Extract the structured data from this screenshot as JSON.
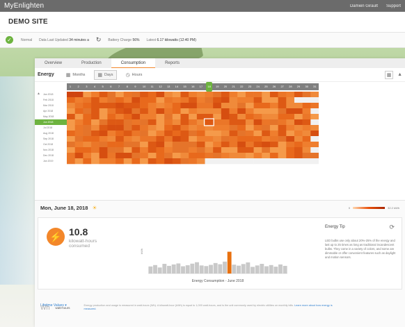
{
  "app": {
    "brand": "MyEnlighten",
    "user": "Damien Girault",
    "support": "Support"
  },
  "site": {
    "name": "DEMO SITE"
  },
  "status": {
    "state": "Normal",
    "updated_label": "Data Last Updated",
    "updated_value": "34 minutes a",
    "battery_label": "Battery Charge",
    "battery_value": "56%",
    "latest_label": "Latest",
    "latest_value": "6.17 kilowatts (12:40 PM)"
  },
  "tabs": [
    "Overview",
    "Production",
    "Consumption",
    "Reports"
  ],
  "active_tab": "Consumption",
  "toolbar": {
    "energy": "Energy",
    "months": "Months",
    "days": "Days",
    "hours": "Hours"
  },
  "heatmap": {
    "days": [
      "1",
      "2",
      "3",
      "4",
      "5",
      "6",
      "7",
      "8",
      "9",
      "10",
      "11",
      "12",
      "13",
      "14",
      "15",
      "16",
      "17",
      "18",
      "19",
      "20",
      "21",
      "22",
      "23",
      "24",
      "25",
      "26",
      "27",
      "28",
      "29",
      "30",
      "31"
    ],
    "selected_day": "18",
    "months": [
      "Jan 2018",
      "Feb 2018",
      "Mar 2018",
      "Apr 2018",
      "May 2018",
      "Jun 2018",
      "Jul 2018",
      "Aug 2018",
      "Sep 2018",
      "Oct 2018",
      "Nov 2018",
      "Dec 2018",
      "Jan 2019"
    ],
    "selected_month": "Jun 2018"
  },
  "detail": {
    "date": "Mon, June 18, 2018",
    "legend_min": "0",
    "legend_max": "32.2 kWh",
    "value": "10.8",
    "value_label": "kilowatt-hours consumed",
    "tip_title": "Energy Tip",
    "tip_text": "LED bulbs use only about 20%-25% of the energy and last up to 25 times as long as traditional incandescent bulbs. They come in a variety of colors, and some are dimmable or offer convenient features such as daylight and motion sensors.",
    "lifetime": "Lifetime Values",
    "colors": {
      "accent": "#f3872a",
      "selected_bar": "#e8700f",
      "bar": "#c9c9c9",
      "green": "#6db33f"
    }
  },
  "chart_data": {
    "type": "bar",
    "title": "Energy Consumption - June 2018",
    "ylabel": "kWh",
    "selected_index": 17,
    "values": [
      3.5,
      4.2,
      3.0,
      4.8,
      3.8,
      4.5,
      5.0,
      3.6,
      4.1,
      4.9,
      5.6,
      4.0,
      3.7,
      4.3,
      5.2,
      4.6,
      5.9,
      10.8,
      4.4,
      3.9,
      4.7,
      5.5,
      3.3,
      4.0,
      4.8,
      3.6,
      4.2,
      3.4,
      4.5,
      3.8
    ],
    "ylim": [
      0,
      22
    ]
  },
  "footer": {
    "unit_short": "Wh",
    "unit_label": "watt-hours",
    "note": "Energy production and usage is measured in watt-hours (Wh). A kilowatt-hour (kWh) is equal to 1,000 watt-hours, and is the unit commonly used by electric utilities on monthly bills.",
    "link": "Learn more about how energy is measured."
  }
}
